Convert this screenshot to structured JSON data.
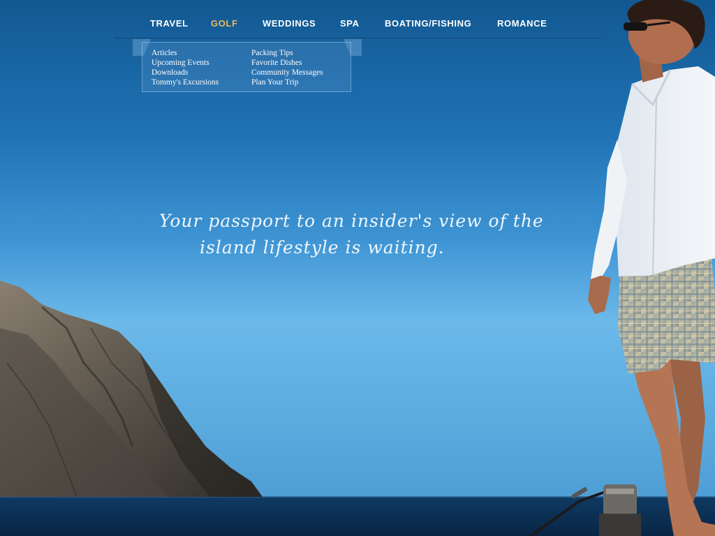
{
  "nav": {
    "items": [
      {
        "label": "TRAVEL"
      },
      {
        "label": "GOLF"
      },
      {
        "label": "WEDDINGS"
      },
      {
        "label": "SPA"
      },
      {
        "label": "BOATING/FISHING"
      },
      {
        "label": "ROMANCE"
      }
    ],
    "active": "GOLF"
  },
  "dropdown": {
    "column1": [
      "Articles",
      "Upcoming Events",
      "Downloads",
      "Tommy's Excursions"
    ],
    "column2": [
      "Packing Tips",
      "Favorite Dishes",
      "Community Messages",
      "Plan Your Trip"
    ]
  },
  "tagline": {
    "line1": "Your passport to an insider's view of the",
    "line2": "island lifestyle is waiting."
  },
  "colors": {
    "nav_text": "#ffffff",
    "nav_active": "#e8b865",
    "sky_top": "#125891",
    "sky_mid": "#6cb9ea",
    "sea": "#0b2c4f"
  },
  "scene": {
    "image": "island-hero-photo",
    "elements": [
      "rocky-cliff",
      "sea",
      "man-in-plaid-shorts",
      "boat-railing"
    ]
  }
}
